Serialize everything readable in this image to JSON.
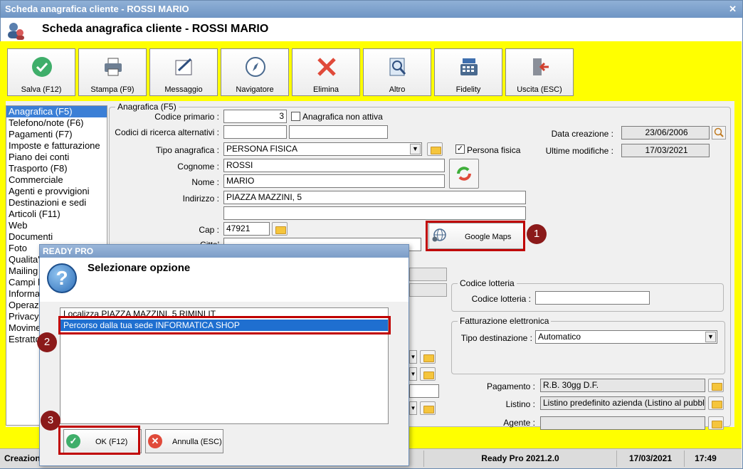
{
  "window": {
    "title": "Scheda anagrafica cliente - ROSSI MARIO",
    "close_glyph": "✕"
  },
  "header": {
    "title": "Scheda anagrafica cliente - ROSSI MARIO"
  },
  "toolbar": {
    "items": [
      {
        "label": "Salva (F12)",
        "icon": "check-icon"
      },
      {
        "label": "Stampa (F9)",
        "icon": "printer-icon"
      },
      {
        "label": "Messaggio",
        "icon": "message-icon"
      },
      {
        "label": "Navigatore",
        "icon": "compass-icon"
      },
      {
        "label": "Elimina",
        "icon": "delete-icon"
      },
      {
        "label": "Altro",
        "icon": "search-doc-icon"
      },
      {
        "label": "Fidelity",
        "icon": "cash-register-icon"
      },
      {
        "label": "Uscita (ESC)",
        "icon": "exit-icon"
      }
    ]
  },
  "sidebar": {
    "items": [
      "Anagrafica (F5)",
      "Telefono/note (F6)",
      "Pagamenti (F7)",
      "Imposte e fatturazione",
      "Piano dei conti",
      "Trasporto (F8)",
      "Commerciale",
      "Agenti e provvigioni",
      "Destinazioni e sedi",
      "Articoli (F11)",
      "Web",
      "Documenti",
      "Foto",
      "Qualita'",
      "Mailing",
      "Campi l",
      "Informa",
      "Operazi",
      "Privacy",
      "Movime",
      "Estratto"
    ],
    "selected": 0
  },
  "form": {
    "group_title": "Anagrafica (F5)",
    "codice_primario_label": "Codice primario :",
    "codice_primario_value": "3",
    "anagrafica_non_attiva_label": "Anagrafica non attiva",
    "codici_ricerca_label": "Codici di ricerca alternativi :",
    "tipo_anagrafica_label": "Tipo anagrafica :",
    "tipo_anagrafica_value": "PERSONA FISICA",
    "persona_fisica_label": "Persona fisica",
    "cognome_label": "Cognome :",
    "cognome_value": "ROSSI",
    "nome_label": "Nome :",
    "nome_value": "MARIO",
    "indirizzo_label": "Indirizzo :",
    "indirizzo_value": "PIAZZA MAZZINI, 5",
    "cap_label": "Cap :",
    "cap_value": "47921",
    "citta_label": "Citta'",
    "google_maps_label": "Google Maps",
    "data_creazione_label": "Data creazione :",
    "data_creazione_value": "23/06/2006",
    "ultime_modifiche_label": "Ultime modifiche :",
    "ultime_modifiche_value": "17/03/2021",
    "lotteria_group": "Codice lotteria",
    "lotteria_label": "Codice lotteria :",
    "fe_group": "Fatturazione elettronica",
    "tipo_dest_label": "Tipo destinazione :",
    "tipo_dest_value": "Automatico",
    "pagamento_label": "Pagamento :",
    "pagamento_value": "R.B. 30gg D.F.",
    "listino_label": "Listino :",
    "listino_value": "Listino predefinito azienda (Listino al pubblico)",
    "agente_label": "Agente :"
  },
  "status": {
    "left": "Creazion",
    "app": "Ready Pro 2021.2.0",
    "date": "17/03/2021",
    "time": "17:49"
  },
  "dialog": {
    "title": "READY PRO",
    "heading": "Selezionare opzione",
    "options": [
      "Localizza PIAZZA MAZZINI, 5 RIMINI IT",
      "Percorso dalla tua sede INFORMATICA SHOP"
    ],
    "selected": 1,
    "ok_label": "OK (F12)",
    "cancel_label": "Annulla (ESC)"
  },
  "callouts": [
    "1",
    "2",
    "3"
  ],
  "colors": {
    "highlight": "#c00000",
    "accent_yellow": "#ffff00",
    "selection": "#1f6fd0"
  }
}
